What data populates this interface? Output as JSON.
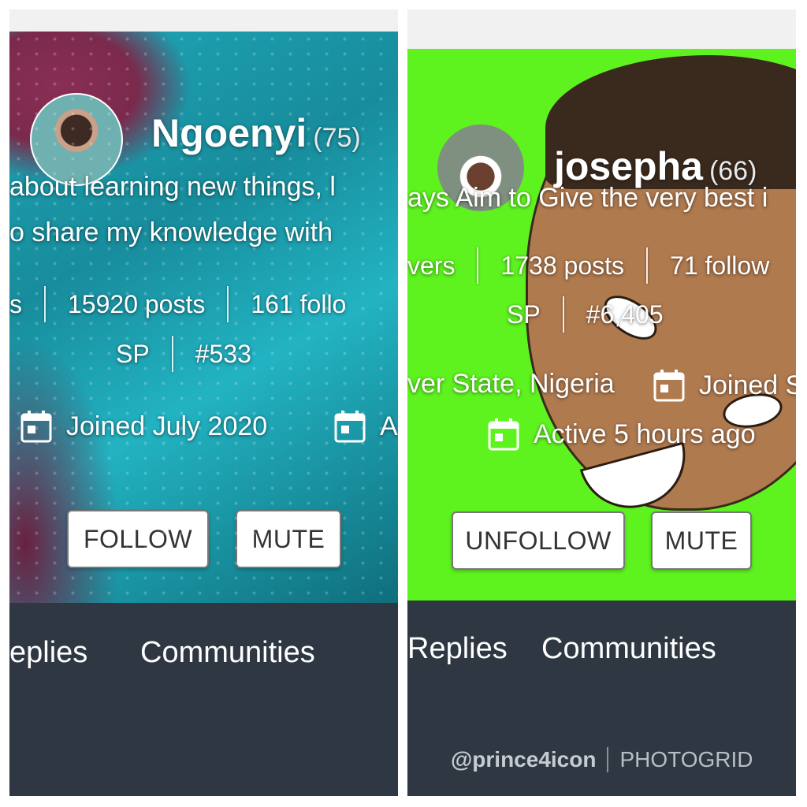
{
  "left": {
    "username": "Ngoenyi",
    "reputation": "(75)",
    "bio_line1": "about learning new things, l",
    "bio_line2": "o share my knowledge with",
    "stats": {
      "followers_fragment": "s",
      "posts": "15920 posts",
      "following_fragment": "161 follo"
    },
    "sp_label": "SP",
    "rank": "#533",
    "joined": "Joined July 2020",
    "active_fragment": "A",
    "follow_button": "FOLLOW",
    "mute_button": "MUTE",
    "tabs": {
      "replies": "eplies",
      "communities": "Communities"
    }
  },
  "right": {
    "username": "josepha",
    "reputation": "(66)",
    "bio_line1": "ays Aim to Give the very best i",
    "stats": {
      "followers_fragment": "vers",
      "posts": "1738 posts",
      "following_fragment": "71 follow"
    },
    "sp_label": "SP",
    "rank": "#6,405",
    "location_fragment": "ver State, Nigeria",
    "joined_fragment": "Joined S",
    "active": "Active 5 hours ago",
    "unfollow_button": "UNFOLLOW",
    "mute_button": "MUTE",
    "tabs": {
      "replies": "Replies",
      "communities": "Communities"
    }
  },
  "watermark": {
    "handle": "@prince4icon",
    "brand": "PHOTOGRID"
  },
  "colors": {
    "left_cover": "#1fa7b8",
    "right_cover": "#5ef31f",
    "tab_bar": "#2e3742",
    "button_bg": "#ffffff"
  }
}
